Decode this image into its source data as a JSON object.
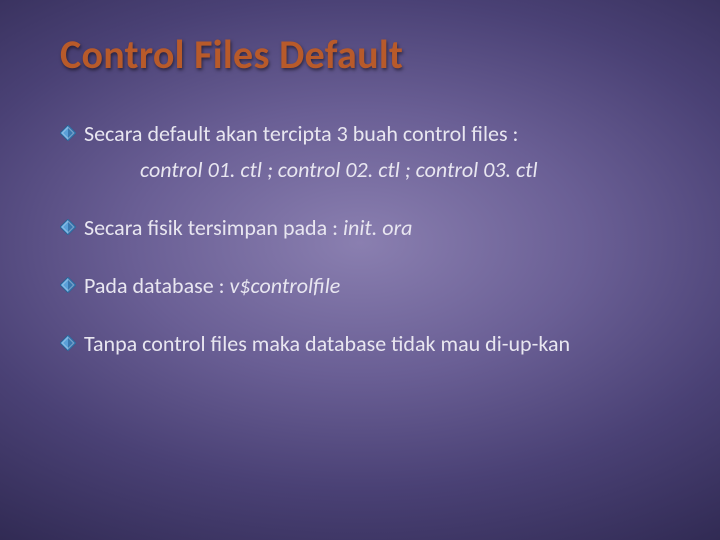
{
  "title": "Control Files Default",
  "bullets": {
    "b1": "Secara default akan tercipta 3 buah control files :",
    "b1_sub": "control 01. ctl ; control 02. ctl ; control 03. ctl",
    "b2_pre": "Secara fisik tersimpan pada : ",
    "b2_em": "init. ora",
    "b3_pre": "Pada database : ",
    "b3_em": "v$controlfile",
    "b4": "Tanpa control files maka database tidak mau di-up-kan"
  }
}
